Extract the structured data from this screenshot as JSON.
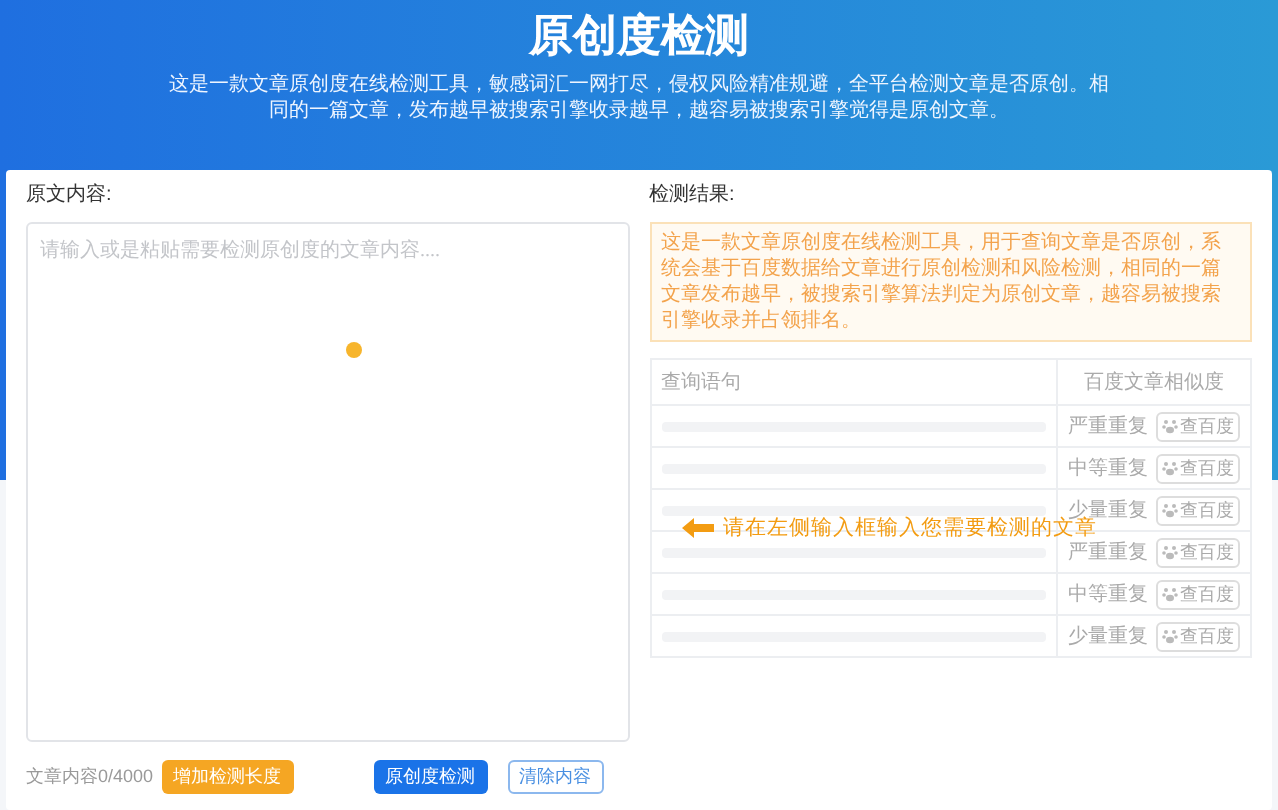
{
  "header": {
    "title": "原创度检测",
    "subtitle": "这是一款文章原创度在线检测工具，敏感词汇一网打尽，侵权风险精准规避，全平台检测文章是否原创。相同的一篇文章，发布越早被搜索引擎收录越早，越容易被搜索引擎觉得是原创文章。"
  },
  "source": {
    "label": "原文内容:",
    "placeholder": "请输入或是粘贴需要检测原创度的文章内容....",
    "counter": "文章内容0/4000",
    "buttons": [
      {
        "kind": "accent",
        "label": "增加检测长度"
      },
      {
        "kind": "primary",
        "label": "原创度检测"
      },
      {
        "kind": "outline",
        "label": "清除内容"
      }
    ]
  },
  "result": {
    "label": "检测结果:",
    "notice": "这是一款文章原创度在线检测工具，用于查询文章是否原创，系统会基于百度数据给文章进行原创检测和风险检测，相同的一篇文章发布越早，被搜索引擎算法判定为原创文章，越容易被搜索引擎收录并占领排名。",
    "columns": [
      "查询语句",
      "百度文章相似度"
    ],
    "rows": [
      {
        "similarity": "严重重复",
        "action": "查百度"
      },
      {
        "similarity": "中等重复",
        "action": "查百度"
      },
      {
        "similarity": "少量重复",
        "action": "查百度"
      },
      {
        "similarity": "严重重复",
        "action": "查百度"
      },
      {
        "similarity": "中等重复",
        "action": "查百度"
      },
      {
        "similarity": "少量重复",
        "action": "查百度"
      }
    ],
    "hint": "请在左侧输入框输入您需要检测的文章"
  }
}
